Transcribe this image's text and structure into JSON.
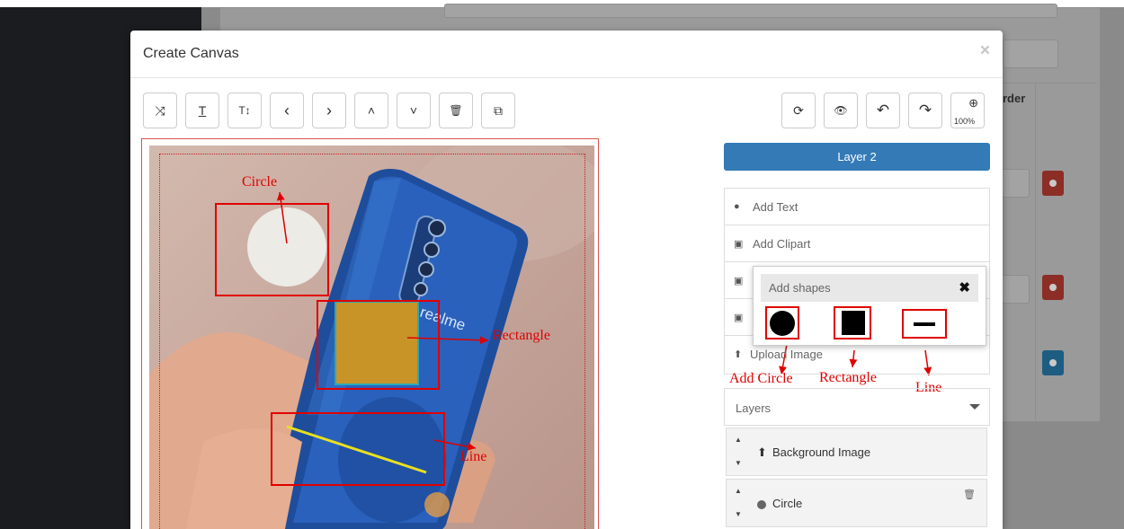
{
  "modal": {
    "title": "Create Canvas",
    "close": "×"
  },
  "toolbar_left": [
    {
      "name": "shuffle-icon",
      "glyph": "⤨"
    },
    {
      "name": "text-icon",
      "glyph": "T"
    },
    {
      "name": "text-size-icon",
      "glyph": "T↕"
    },
    {
      "name": "chevron-left-icon",
      "glyph": "‹"
    },
    {
      "name": "chevron-right-icon",
      "glyph": "›"
    },
    {
      "name": "chevron-up-icon",
      "glyph": "˄"
    },
    {
      "name": "chevron-down-icon",
      "glyph": "˅"
    },
    {
      "name": "trash-icon",
      "glyph": "🗑"
    },
    {
      "name": "duplicate-icon",
      "glyph": "⧉"
    }
  ],
  "toolbar_right": [
    {
      "name": "refresh-icon",
      "glyph": "⟳"
    },
    {
      "name": "eye-icon",
      "glyph": "👁"
    },
    {
      "name": "undo-icon",
      "glyph": "↶"
    },
    {
      "name": "redo-icon",
      "glyph": "↷"
    }
  ],
  "zoom": {
    "level": "100%"
  },
  "right_panel": {
    "active_layer": "Layer 2",
    "menu": {
      "add_text": "Add Text",
      "add_clipart": "Add Clipart",
      "upload_image": "Upload Image"
    },
    "shapes_popup": {
      "title": "Add shapes",
      "close": "✖"
    },
    "layers": {
      "header": "Layers",
      "items": [
        {
          "label": "Background Image"
        },
        {
          "label": "Circle"
        }
      ]
    }
  },
  "annotations": {
    "circle": "Circle",
    "rectangle": "Rectangle",
    "line": "Line",
    "add_circle": "Add Circle",
    "rectangle_shape": "Rectangle",
    "line_shape": "Line"
  },
  "background_page": {
    "column_header": "rder"
  },
  "colors": {
    "primary": "#337ab7",
    "annotation_red": "#e00000",
    "rect_fill": "#c89428",
    "line_yellow": "#e8e020",
    "circle_fill": "#ecebe6"
  }
}
